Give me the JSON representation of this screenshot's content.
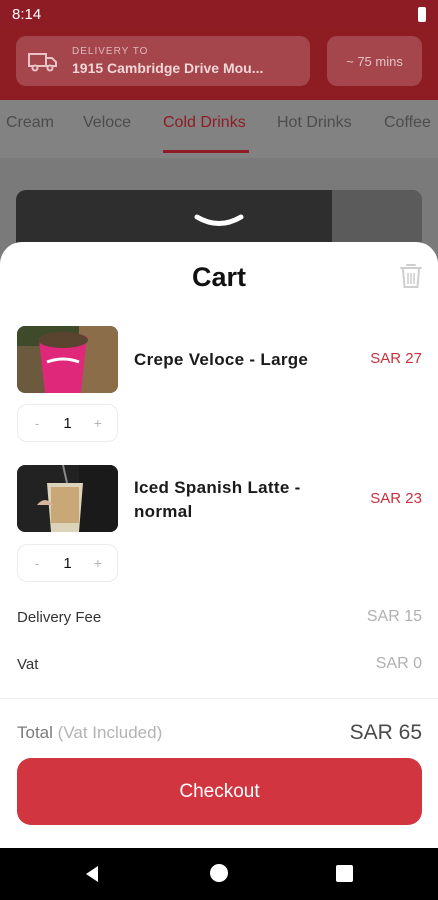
{
  "status_bar": {
    "time": "8:14"
  },
  "header": {
    "delivery_label": "DELIVERY TO",
    "delivery_address": "1915 Cambridge Drive Mou...",
    "eta": "~ 75 mins"
  },
  "categories": [
    "Cream",
    "Veloce",
    "Cold Drinks",
    "Hot Drinks",
    "Coffee"
  ],
  "active_category": "Cold Drinks",
  "cart": {
    "title": "Cart",
    "items": [
      {
        "name": "Crepe Veloce - Large",
        "price": "SAR 27",
        "qty": "1",
        "minus": "-",
        "plus": "+"
      },
      {
        "name": "Iced Spanish Latte - normal",
        "price": "SAR 23",
        "qty": "1",
        "minus": "-",
        "plus": "+"
      }
    ],
    "delivery_fee_label": "Delivery Fee",
    "delivery_fee_value": "SAR 15",
    "vat_label": "Vat",
    "vat_value": "SAR 0",
    "total_label": "Total",
    "total_sub": "(Vat Included)",
    "total_value": "SAR 65",
    "checkout_label": "Checkout"
  },
  "colors": {
    "brand": "#d1353f",
    "price": "#c8303d"
  }
}
